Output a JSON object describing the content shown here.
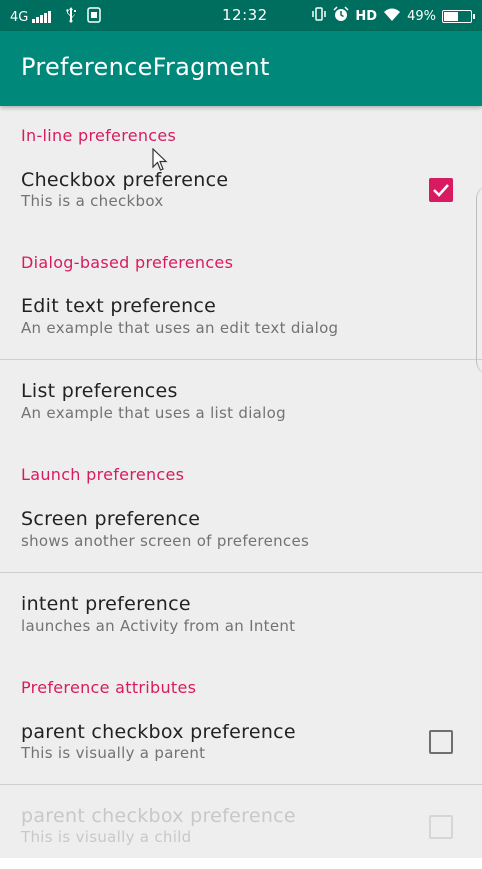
{
  "status_bar": {
    "network": "4G",
    "time": "12:32",
    "hd": "HD",
    "battery": "49%",
    "battery_level": 0.49,
    "icons": [
      "signal-icon",
      "usb-icon",
      "notification-icon",
      "vibrate-icon",
      "alarm-icon",
      "wifi-icon",
      "battery-icon"
    ]
  },
  "app_bar": {
    "title": "PreferenceFragment"
  },
  "colors": {
    "status_bar": "#006e5e",
    "app_bar": "#00897b",
    "accent": "#d81b60",
    "background": "#eeeeee"
  },
  "categories": [
    "In-line preferences",
    "Dialog-based preferences",
    "Launch preferences",
    "Preference attributes"
  ],
  "preferences": {
    "checkbox": {
      "title": "Checkbox preference",
      "summary": "This is a checkbox",
      "checked": true
    },
    "edit_text": {
      "title": "Edit text preference",
      "summary": "An example that uses an edit text dialog"
    },
    "list": {
      "title": "List preferences",
      "summary": "An example that uses a list dialog"
    },
    "screen": {
      "title": "Screen preference",
      "summary": "shows another screen of preferences"
    },
    "intent": {
      "title": "intent preference",
      "summary": "launches an Activity from an Intent"
    },
    "parent": {
      "title": "parent checkbox preference",
      "summary": "This is visually a parent",
      "checked": false
    },
    "child": {
      "title": "parent checkbox preference",
      "summary": "This is visually a child",
      "checked": false,
      "enabled": false
    }
  }
}
